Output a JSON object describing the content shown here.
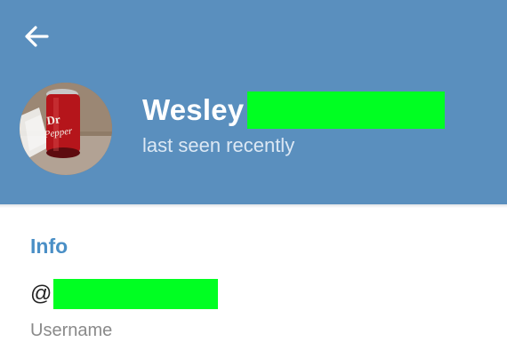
{
  "header": {
    "background_color": "#5a8fbe",
    "back_icon": "arrow-left-icon",
    "profile": {
      "name": "Wesley",
      "status": "last seen recently",
      "avatar": "profile-photo-soda-can"
    }
  },
  "info_section": {
    "title": "Info",
    "title_color": "#4a8fc6",
    "username": {
      "prefix": "@",
      "label": "Username"
    }
  },
  "redaction_color": "#00ff22"
}
